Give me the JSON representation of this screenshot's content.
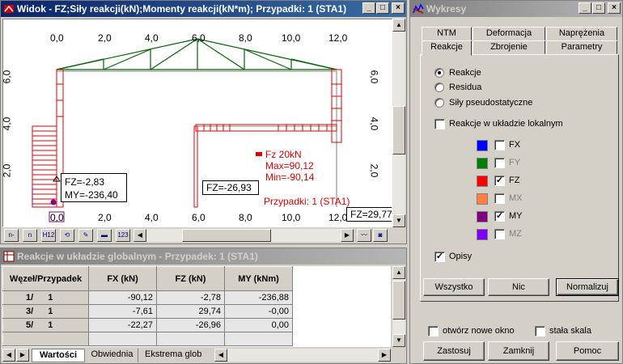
{
  "view_window": {
    "title": "Widok - FZ;Siły reakcji(kN);Momenty reakcji(kN*m); Przypadki: 1 (STA1)",
    "top_ticks": [
      "0,0",
      "2,0",
      "4,0",
      "6,0",
      "8,0",
      "10,0",
      "12,0"
    ],
    "bottom_ticks": [
      "0,0",
      "2,0",
      "4,0",
      "6,0",
      "8,0",
      "10,0",
      "12,0"
    ],
    "right_ticks": [
      "6,0",
      "4,0",
      "2,0"
    ],
    "left_ticks": [
      "6,0",
      "4,0",
      "2,0"
    ],
    "legend": {
      "fz": "Fz  20kN",
      "max": "Max=90,12",
      "min": "Min=-90,14",
      "cases": "Przypadki: 1 (STA1)"
    },
    "label_node1_fz": "FZ=-2,83",
    "label_node1_my": "MY=-236,40",
    "label_node3": "FZ=-26,93",
    "label_node5": "FZ=29,77",
    "toolbar_icons": [
      "n-",
      "n",
      "H12",
      "rotate",
      "pen",
      "flag",
      "123"
    ]
  },
  "reactions_window": {
    "title": "Reakcje w układzie globalnym - Przypadek: 1 (STA1)",
    "columns": [
      "Węzeł/Przypadek",
      "FX (kN)",
      "FZ (kN)",
      "MY (kNm)"
    ],
    "rows": [
      {
        "node": "1/",
        "case": "1",
        "fx": "-90,12",
        "fz": "-2,78",
        "my": "-236,88"
      },
      {
        "node": "3/",
        "case": "1",
        "fx": "-7,61",
        "fz": "29,74",
        "my": "-0,00"
      },
      {
        "node": "5/",
        "case": "1",
        "fx": "-22,27",
        "fz": "-26,96",
        "my": "0,00"
      }
    ],
    "tabs": [
      "Wartości",
      "Obwiednia",
      "Ekstrema glob"
    ]
  },
  "wykresy": {
    "title": "Wykresy",
    "tabs_row1": [
      "NTM",
      "Deformacja",
      "Naprężenia"
    ],
    "tabs_row2": [
      "Reakcje",
      "Zbrojenie",
      "Parametry"
    ],
    "radio_reakcje": "Reakcje",
    "radio_residua": "Residua",
    "radio_sily": "Siły pseudostatyczne",
    "chk_lokalny": "Reakcje w układzie lokalnym",
    "components": [
      {
        "label": "FX",
        "color": "#0000ff",
        "checked": false,
        "enabled": true
      },
      {
        "label": "FY",
        "color": "#008000",
        "checked": false,
        "enabled": false
      },
      {
        "label": "FZ",
        "color": "#ff0000",
        "checked": true,
        "enabled": true
      },
      {
        "label": "MX",
        "color": "#ff8040",
        "checked": false,
        "enabled": false
      },
      {
        "label": "MY",
        "color": "#800080",
        "checked": true,
        "enabled": true
      },
      {
        "label": "MZ",
        "color": "#8000ff",
        "checked": false,
        "enabled": false
      }
    ],
    "chk_opisy": "Opisy",
    "btn_wszystko": "Wszystko",
    "btn_nic": "Nic",
    "btn_normalizuj": "Normalizuj",
    "chk_otworz": "otwórz nowe okno",
    "chk_stala": "stała  skala",
    "btn_zastosuj": "Zastosuj",
    "btn_zamknij": "Zamknij",
    "btn_pomoc": "Pomoc"
  }
}
